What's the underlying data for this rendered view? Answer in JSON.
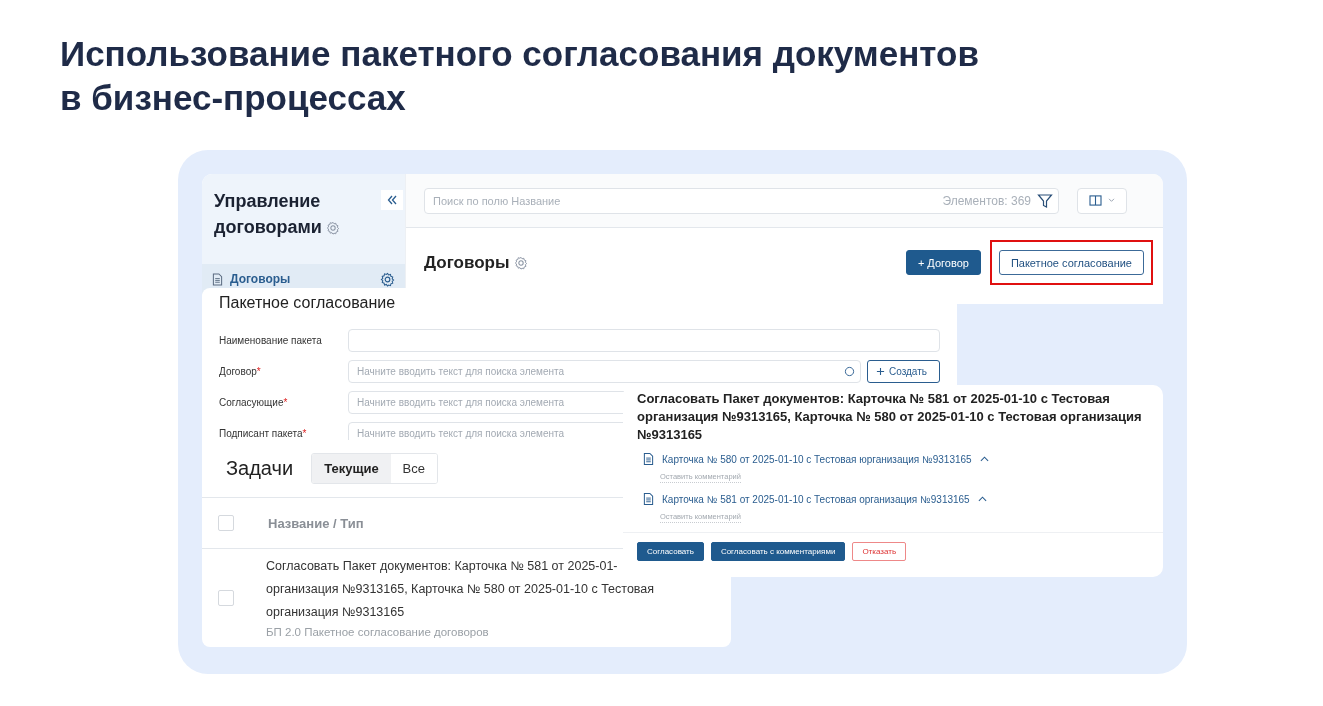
{
  "heading_lines": [
    "Использование пакетного согласования документов",
    "в бизнес-процессах"
  ],
  "app": {
    "sidebar": {
      "title": "Управление договорами",
      "items": [
        {
          "label": "Договоры",
          "selected": true
        }
      ]
    },
    "search": {
      "placeholder": "Поиск по полю Название",
      "count": "Элементов: 369"
    },
    "page_title": "Договоры",
    "buttons": [
      {
        "label": "+ Договор",
        "kind": "primary",
        "highlighted": false
      },
      {
        "label": "Пакетное согласование",
        "kind": "outline",
        "highlighted": true
      }
    ]
  },
  "form": {
    "title": "Пакетное согласование",
    "fields": [
      {
        "label": "Наименование пакета"
      },
      {
        "label": "Договор",
        "required_mark": "*",
        "placeholder": "Начните вводить текст для поиска элемента",
        "create_button": "Создать"
      },
      {
        "label": "Согласующие",
        "required_mark": "*",
        "placeholder": "Начните вводить текст для поиска элемента"
      },
      {
        "label": "Подписант пакета",
        "required_mark": "*",
        "placeholder": "Начните вводить текст для поиска элемента"
      }
    ]
  },
  "tasks": {
    "title": "Задачи",
    "tabs": [
      {
        "label": "Текущие",
        "selected": true
      },
      {
        "label": "Все",
        "selected": false
      }
    ],
    "header_checked": false,
    "columns": [
      "Название / Тип"
    ],
    "rows": [
      {
        "checked": false,
        "title_lines": [
          "Согласовать Пакет документов: Карточка № 581 от 2025-01-",
          "организация №9313165, Карточка № 580 от 2025-01-10 с Тестовая",
          "организация №9313165"
        ],
        "subtitle": "БП 2.0 Пакетное согласование договоров"
      }
    ]
  },
  "approval": {
    "title": "Согласовать Пакет документов: Карточка № 581 от 2025-01-10 с Тестовая организация №9313165, Карточка № 580 от 2025-01-10 с Тестовая организация №9313165",
    "documents": [
      {
        "title": "Карточка № 580 от 2025-01-10 с Тестовая юрганизация №9313165",
        "expanded": true,
        "comment_placeholder": "Оставить комментарий"
      },
      {
        "title": "Карточка № 581 от 2025-01-10 с Тестовая организация №9313165",
        "expanded": true,
        "comment_placeholder": "Оставить комментарий"
      }
    ],
    "actions": [
      {
        "label": "Согласовать",
        "kind": "primary"
      },
      {
        "label": "Согласовать с комментариями",
        "kind": "primary"
      },
      {
        "label": "Отказать",
        "kind": "danger"
      }
    ]
  }
}
